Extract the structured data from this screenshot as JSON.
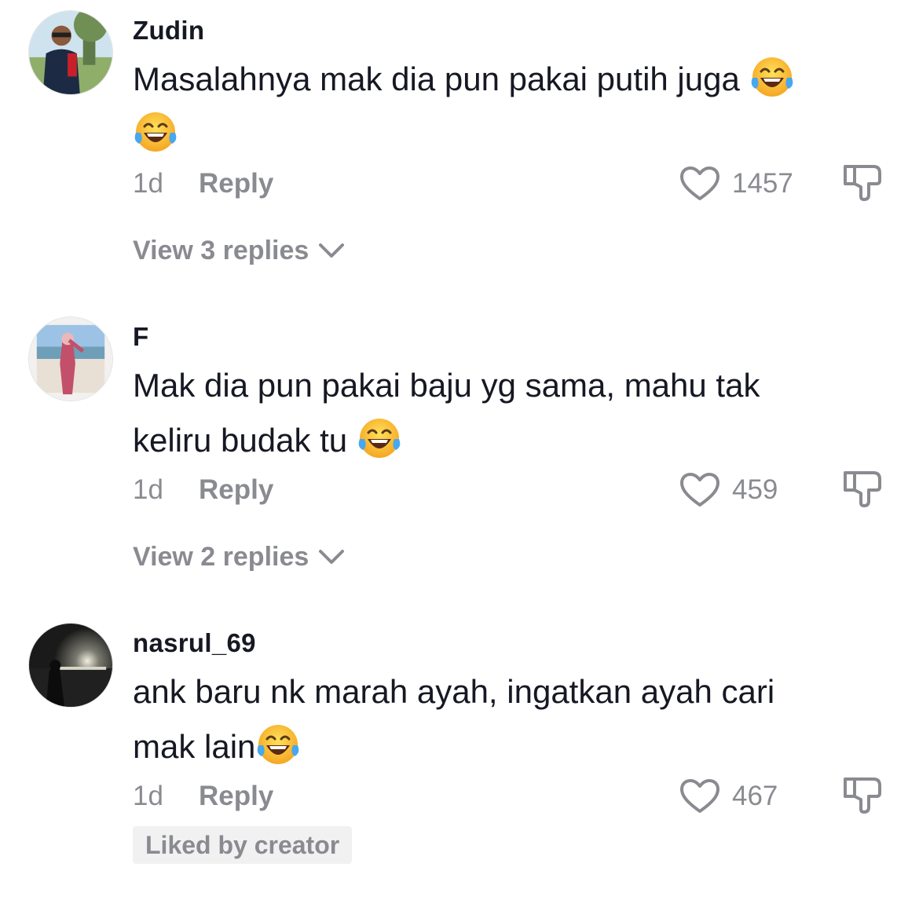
{
  "comments": [
    {
      "username": "Zudin",
      "text": "Masalahnya mak dia pun pakai putih juga",
      "emojis": [
        "face-with-tears-of-joy",
        "face-with-tears-of-joy"
      ],
      "time": "1d",
      "reply_label": "Reply",
      "likes": "1457",
      "view_replies": "View 3 replies"
    },
    {
      "username": "F",
      "text": "Mak dia pun pakai baju yg sama, mahu tak keliru budak tu",
      "emojis": [
        "face-with-tears-of-joy"
      ],
      "time": "1d",
      "reply_label": "Reply",
      "likes": "459",
      "view_replies": "View 2 replies"
    },
    {
      "username": "nasrul_69",
      "text": "ank baru nk marah ayah, ingatkan ayah cari mak lain",
      "emojis": [
        "face-with-tears-of-joy"
      ],
      "time": "1d",
      "reply_label": "Reply",
      "likes": "467",
      "badge": "Liked by creator"
    }
  ],
  "icons": {
    "like": "heart-outline-icon",
    "dislike": "thumbs-down-outline-icon",
    "expand": "chevron-down-icon"
  },
  "colors": {
    "text_primary": "#161823",
    "text_secondary": "#8a8b91",
    "badge_background": "#f1f1f2"
  }
}
